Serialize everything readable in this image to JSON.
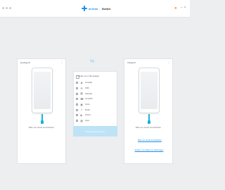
{
  "header": {
    "brand": "dr.fone",
    "separator": "-",
    "product": "Switch",
    "help_icon": "bulb-icon"
  },
  "source": {
    "label": "Quellgerät",
    "hint": "Bitte ein Gerät anschließen"
  },
  "target": {
    "label": "Zielgerät",
    "hint": "Bitte ein Gerät anschließen",
    "link": "Bitte ein Gerät anschließen"
  },
  "content": {
    "header": "Inhalte zum Übertragen",
    "items": [
      {
        "label": "Kontakte",
        "icon": "contacts-icon"
      },
      {
        "label": "SMS",
        "icon": "sms-icon"
      },
      {
        "label": "Kalender",
        "icon": "calendar-icon"
      },
      {
        "label": "Anrufliste",
        "icon": "call-log-icon"
      },
      {
        "label": "Fotos",
        "icon": "photo-icon"
      },
      {
        "label": "Musik",
        "icon": "music-icon"
      },
      {
        "label": "Videos",
        "icon": "video-icon"
      },
      {
        "label": "Apps",
        "icon": "apps-icon"
      }
    ],
    "start_button": "Übertragung starten"
  },
  "footer": {
    "link": "Klicken, um Daten zu übertragen"
  },
  "colors": {
    "accent": "#1a8fe8",
    "cable": "#1ab3d8",
    "button_disabled": "#bfe3f6"
  }
}
